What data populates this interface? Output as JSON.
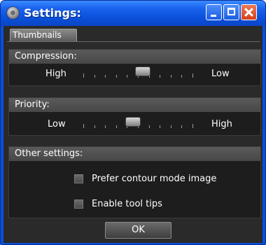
{
  "window": {
    "title": "Settings:"
  },
  "tabs": [
    {
      "label": "Thumbnails"
    }
  ],
  "compression": {
    "header": "Compression:",
    "left_label": "High",
    "right_label": "Low",
    "level": 0.55
  },
  "priority": {
    "header": "Priority:",
    "left_label": "Low",
    "right_label": "High",
    "level": 0.45
  },
  "other": {
    "header": "Other settings:",
    "options": [
      {
        "label": "Prefer contour mode image",
        "checked": false
      },
      {
        "label": "Enable tool tips",
        "checked": false
      }
    ]
  },
  "ok_label": "OK",
  "icons": {
    "app": "settings-app-icon",
    "minimize": "minimize-icon",
    "maximize": "maximize-icon",
    "close": "close-icon"
  }
}
